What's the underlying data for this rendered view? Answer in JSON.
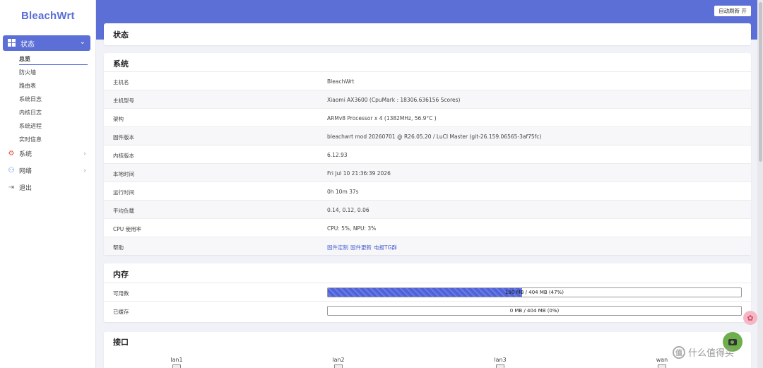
{
  "sidebar": {
    "brand": "BleachWrt",
    "status_label": "状态",
    "status_sub": [
      "总览",
      "防火墙",
      "路由表",
      "系统日志",
      "内核日志",
      "系统进程",
      "实时信息"
    ],
    "system_label": "系统",
    "network_label": "网络",
    "logout_label": "退出"
  },
  "header": {
    "auto_refresh": "自动刷新 开"
  },
  "page_title": "状态",
  "system": {
    "title": "系统",
    "rows": [
      {
        "k": "主机名",
        "v": "BleachWrt"
      },
      {
        "k": "主机型号",
        "v": "Xiaomi AX3600 (CpuMark : 18306.636156 Scores)"
      },
      {
        "k": "架构",
        "v": "ARMv8 Processor x 4 (1382MHz, 56.9°C )"
      },
      {
        "k": "固件版本",
        "v": "bleachwrt mod 20260701 @ R26.05.20 / LuCI Master (git-26.159.06565-3af75fc)"
      },
      {
        "k": "内核版本",
        "v": "6.12.93"
      },
      {
        "k": "本地时间",
        "v": "Fri Jul 10 21:36:39 2026"
      },
      {
        "k": "运行时间",
        "v": "0h 10m 37s"
      },
      {
        "k": "平均负载",
        "v": "0.14, 0.12, 0.06"
      },
      {
        "k": "CPU 使用率",
        "v": "CPU: 5%, NPU: 3%"
      }
    ],
    "help_label": "帮助",
    "help_links": [
      "固件定制",
      "固件更新",
      "电报TG群"
    ]
  },
  "memory": {
    "title": "内存",
    "available_label": "可用数",
    "available_text": "190 MB / 404 MB (47%)",
    "available_percent": 47,
    "cached_label": "已缓存",
    "cached_text": "0 MB / 404 MB (0%)",
    "cached_percent": 0
  },
  "interfaces": {
    "title": "接口",
    "ports": [
      "lan1",
      "lan2",
      "lan3",
      "wan"
    ]
  },
  "watermark": "什么值得买",
  "colors": {
    "accent": "#5b6fd6",
    "link": "#4a5fd0"
  }
}
